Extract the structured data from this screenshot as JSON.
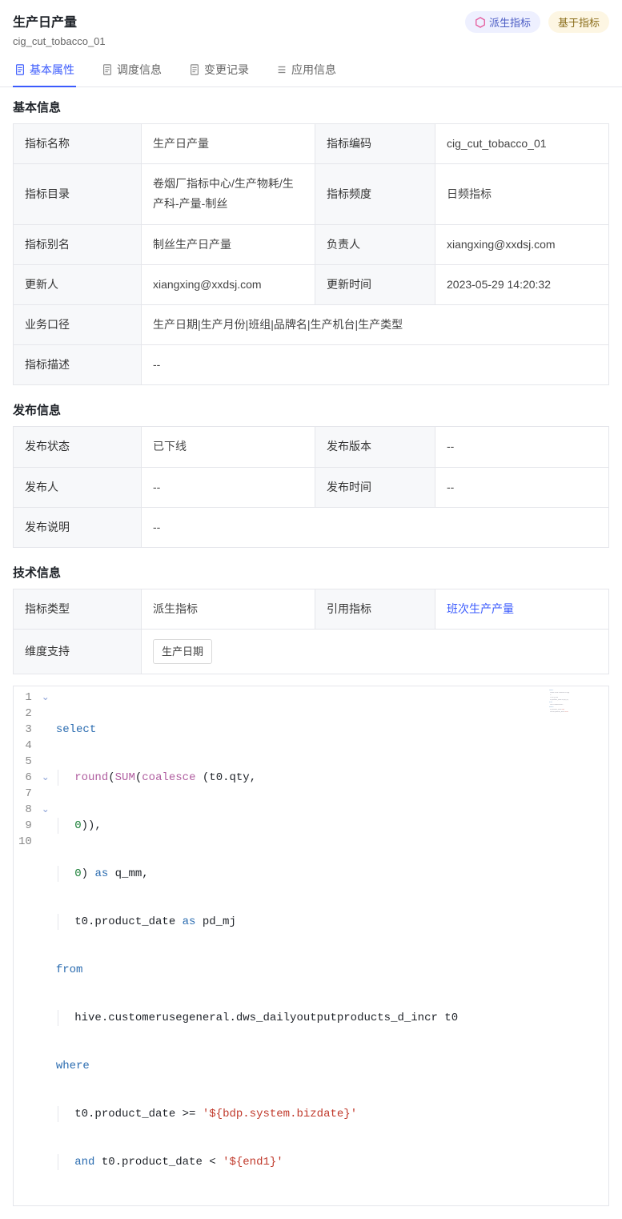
{
  "header": {
    "title": "生产日产量",
    "subtitle": "cig_cut_tobacco_01",
    "tag_derived": "派生指标",
    "tag_based": "基于指标"
  },
  "tabs": [
    {
      "label": "基本属性",
      "icon": "doc-icon"
    },
    {
      "label": "调度信息",
      "icon": "doc-icon"
    },
    {
      "label": "变更记录",
      "icon": "doc-icon"
    },
    {
      "label": "应用信息",
      "icon": "list-icon"
    }
  ],
  "sections": {
    "basic": {
      "title": "基本信息",
      "rows": {
        "name_label": "指标名称",
        "name_value": "生产日产量",
        "code_label": "指标编码",
        "code_value": "cig_cut_tobacco_01",
        "dir_label": "指标目录",
        "dir_value": "卷烟厂指标中心/生产物耗/生产科-产量-制丝",
        "freq_label": "指标频度",
        "freq_value": "日频指标",
        "alias_label": "指标别名",
        "alias_value": "制丝生产日产量",
        "owner_label": "负责人",
        "owner_value": "xiangxing@xxdsj.com",
        "updater_label": "更新人",
        "updater_value": "xiangxing@xxdsj.com",
        "updatetime_label": "更新时间",
        "updatetime_value": "2023-05-29 14:20:32",
        "biz_label": "业务口径",
        "biz_value": "生产日期|生产月份|班组|品牌名|生产机台|生产类型",
        "desc_label": "指标描述",
        "desc_value": "--"
      }
    },
    "publish": {
      "title": "发布信息",
      "rows": {
        "state_label": "发布状态",
        "state_value": "已下线",
        "version_label": "发布版本",
        "version_value": "--",
        "person_label": "发布人",
        "person_value": "--",
        "time_label": "发布时间",
        "time_value": "--",
        "note_label": "发布说明",
        "note_value": "--"
      }
    },
    "tech": {
      "title": "技术信息",
      "rows": {
        "type_label": "指标类型",
        "type_value": "派生指标",
        "ref_label": "引用指标",
        "ref_value": "班次生产产量",
        "dim_label": "维度支持",
        "dim_value": "生产日期"
      }
    }
  },
  "code": {
    "lines": [
      "select",
      "    round(SUM(coalesce (t0.qty,",
      "    0)),",
      "    0) as q_mm,",
      "    t0.product_date as pd_mj",
      "from",
      "    hive.customerusegeneral.dws_dailyoutputproducts_d_incr t0",
      "where",
      "    t0.product_date >= '${bdp.system.bizdate}'",
      "    and t0.product_date < '${end1}'"
    ]
  }
}
